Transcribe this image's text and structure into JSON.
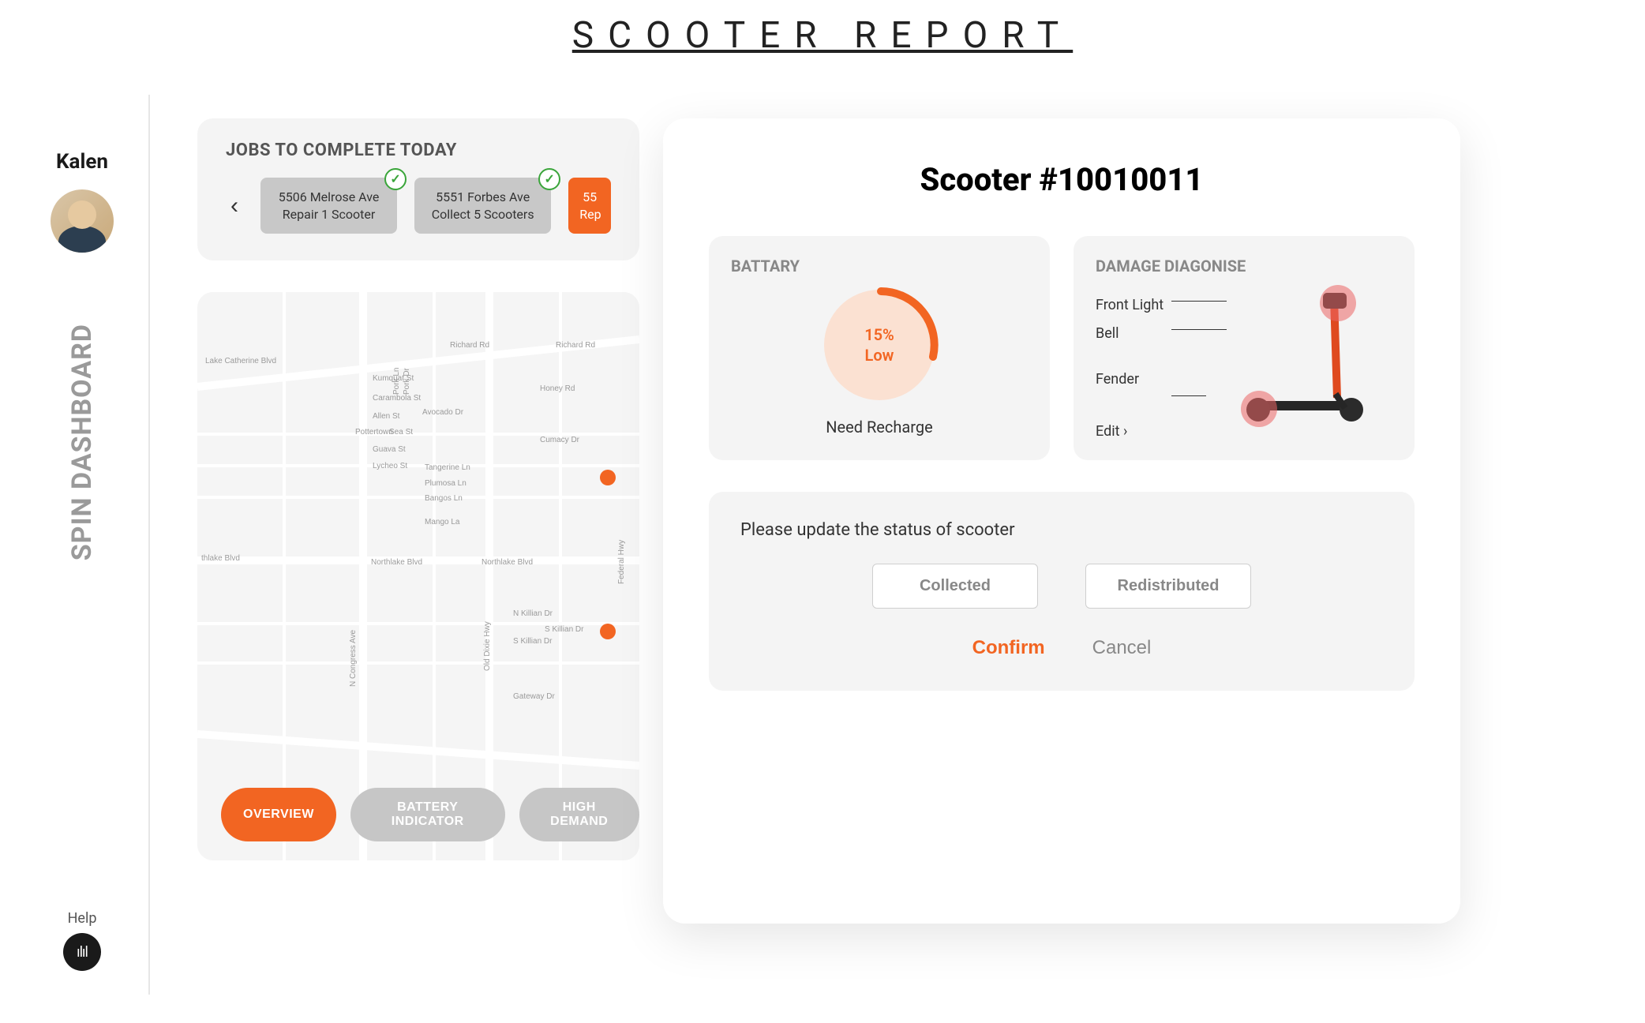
{
  "page_title": "SCOOTER REPORT",
  "sidebar": {
    "username": "Kalen",
    "brand": "SPIN DASHBOARD",
    "help_label": "Help"
  },
  "jobs": {
    "heading": "JOBS TO COMPLETE TODAY",
    "cards": [
      {
        "line1": "5506 Melrose Ave",
        "line2": "Repair 1 Scooter",
        "done": true
      },
      {
        "line1": "5551 Forbes Ave",
        "line2": "Collect 5 Scooters",
        "done": true
      },
      {
        "line1": "55",
        "line2": "Rep",
        "active": true
      }
    ]
  },
  "map": {
    "tabs": {
      "overview": "OVERVIEW",
      "battery": "BATTERY INDICATOR",
      "demand": "HIGH DEMAND"
    },
    "streets": [
      "Lake Catherine Blvd",
      "Richard Rd",
      "Kumquat St",
      "Carambola St",
      "Allen St",
      "Pottertown",
      "Avocado Dr",
      "Guava St",
      "Lycheo St",
      "Honey Rd",
      "Cumacy Dr",
      "Tangerine Ln",
      "Plumosa Ln",
      "Bangos Ln",
      "Mango La",
      "Northlake Blvd",
      "N Congress Ave",
      "Old Dixie Hwy",
      "S Killian Dr",
      "N Killian Dr",
      "Gateway Dr",
      "Pork Ln",
      "Pork Dr",
      "Sea St",
      "Federal Hwy",
      "thlake Blvd"
    ]
  },
  "modal": {
    "title": "Scooter #10010011",
    "battery": {
      "heading": "BATTARY",
      "percent_text": "15%",
      "level_text": "Low",
      "caption": "Need Recharge",
      "percent_value": 15
    },
    "damage": {
      "heading": "DAMAGE DIAGONISE",
      "parts": [
        "Front Light",
        "Bell",
        "Fender"
      ],
      "edit_label": "Edit ›"
    },
    "update": {
      "prompt": "Please update the status of scooter",
      "collected": "Collected",
      "redistributed": "Redistributed",
      "confirm": "Confirm",
      "cancel": "Cancel"
    }
  }
}
